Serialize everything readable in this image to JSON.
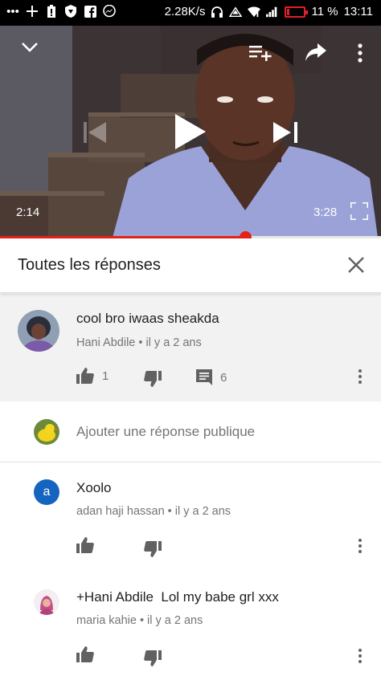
{
  "status_bar": {
    "speed": "2.28K/s",
    "battery": "11 %",
    "time": "13:11",
    "icons": [
      "more-dots-icon",
      "plus-icon",
      "battery-alert-icon",
      "vpn-shield-icon",
      "facebook-icon",
      "messenger-icon",
      "headphones-icon",
      "nfc-icon",
      "wifi-icon",
      "signal-icon",
      "battery-icon"
    ]
  },
  "player": {
    "current_time": "2:14",
    "duration": "3:28",
    "progress": 0.643
  },
  "panel": {
    "title": "Toutes les réponses"
  },
  "original_comment": {
    "text": "cool bro iwaas sheakda",
    "author": "Hani Abdile",
    "age": "il y a 2 ans",
    "likes": "1",
    "replies": "6"
  },
  "reply_box": {
    "placeholder": "Ajouter une réponse publique"
  },
  "replies": [
    {
      "avatar_letter": "a",
      "text": "Xoolo",
      "author": "adan haji hassan",
      "age": "il y a 2 ans"
    },
    {
      "text": "+Hani Abdile  Lol my babe grl xxx",
      "author": "maria kahie",
      "age": "il y a 2 ans"
    }
  ],
  "colors": {
    "accent_red": "#e62117",
    "highlight_bg": "#f2f2f2",
    "avatar_blue": "#1565c0"
  }
}
